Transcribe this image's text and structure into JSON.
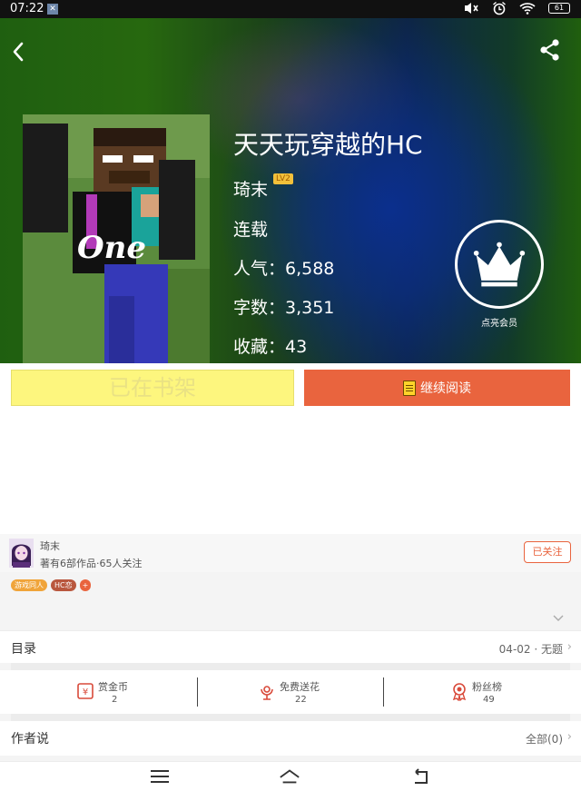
{
  "statusbar": {
    "time": "07:22",
    "notif": "✕",
    "battery": "61"
  },
  "book": {
    "title": "天天玩穿越的HC",
    "author": "琦末",
    "author_level": "LV2",
    "status": "连载",
    "popularity": "人气：6,588",
    "word_count": "字数：3,351",
    "favorites": "收藏：43",
    "cover_text": "One"
  },
  "vip": {
    "label": "点亮会员"
  },
  "buttons": {
    "shelf": "已在书架",
    "read": "继续阅读"
  },
  "author_info": {
    "name": "琦末",
    "meta": "著有6部作品·65人关注",
    "follow": "已关注",
    "tags": [
      "游戏同人",
      "HC恋",
      "+"
    ]
  },
  "toc": {
    "label": "目录",
    "latest": "04-02 · 无题"
  },
  "stats": [
    {
      "label": "赏金币",
      "value": "2",
      "icon": "reward-coin-icon"
    },
    {
      "label": "免费送花",
      "value": "22",
      "icon": "flower-icon"
    },
    {
      "label": "粉丝榜",
      "value": "49",
      "icon": "medal-icon"
    }
  ],
  "author_says": {
    "label": "作者说",
    "count": "全部(0)"
  },
  "colors": {
    "accent": "#e9643e",
    "shelf_button": "#fdf67e",
    "hero_green": "#27680f",
    "hero_blue": "#0b2f8d"
  }
}
